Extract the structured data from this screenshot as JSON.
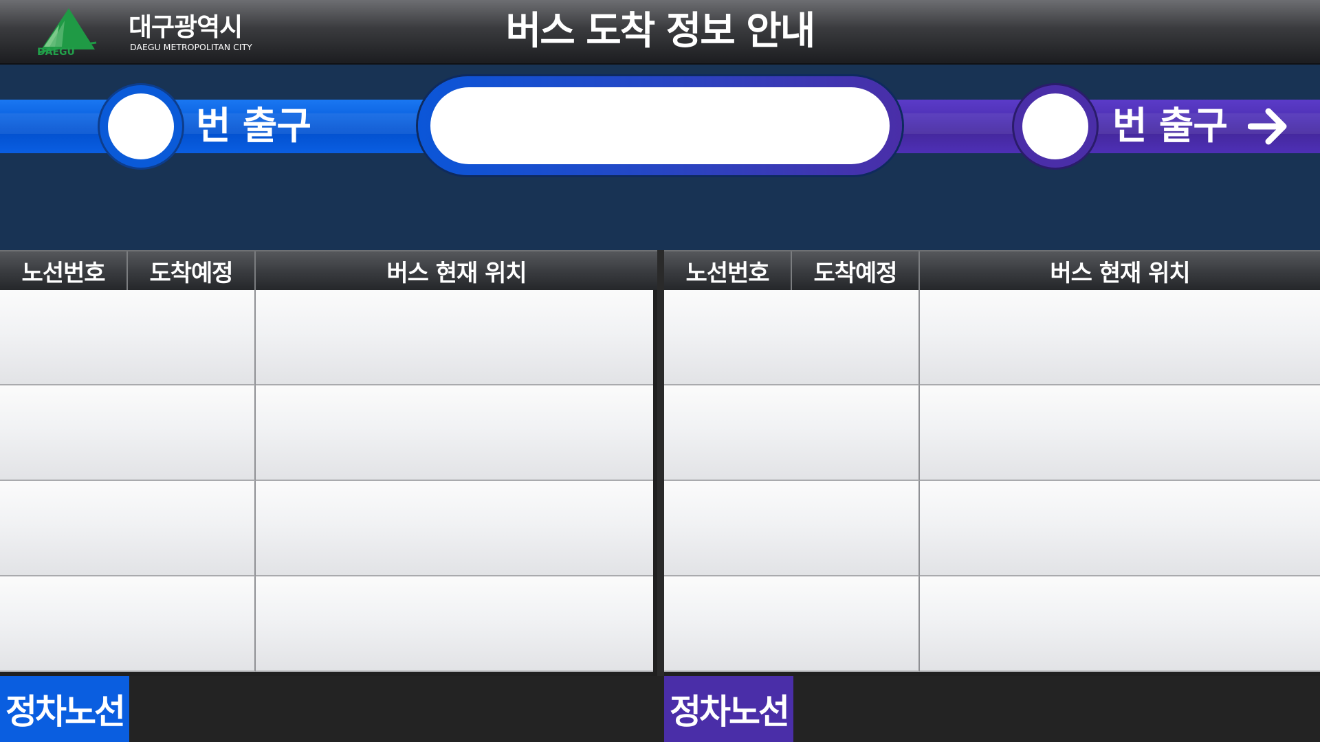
{
  "header": {
    "logo_text": "DAEGU",
    "city_name": "대구광역시",
    "city_name_en": "DAEGU METROPOLITAN CITY",
    "title": "버스 도착 정보 안내"
  },
  "banner": {
    "left_exit_number": "",
    "left_exit_label": "번 출구",
    "station_name": "",
    "right_exit_number": "",
    "right_exit_label": "번 출구",
    "arrow_icon": "arrow-right-icon",
    "colors": {
      "left": "#0a5ee0",
      "right": "#4a2ea8"
    }
  },
  "tables": {
    "left": {
      "headers": [
        "노선번호",
        "도착예정",
        "버스 현재 위치"
      ],
      "rows": [
        {
          "route": "",
          "location": ""
        },
        {
          "route": "",
          "location": ""
        },
        {
          "route": "",
          "location": ""
        },
        {
          "route": "",
          "location": ""
        }
      ]
    },
    "right": {
      "headers": [
        "노선번호",
        "도착예정",
        "버스 현재 위치"
      ],
      "rows": [
        {
          "route": "",
          "location": ""
        },
        {
          "route": "",
          "location": ""
        },
        {
          "route": "",
          "location": ""
        },
        {
          "route": "",
          "location": ""
        }
      ]
    }
  },
  "footer": {
    "left_label": "정차노선",
    "right_label": "정차노선"
  }
}
